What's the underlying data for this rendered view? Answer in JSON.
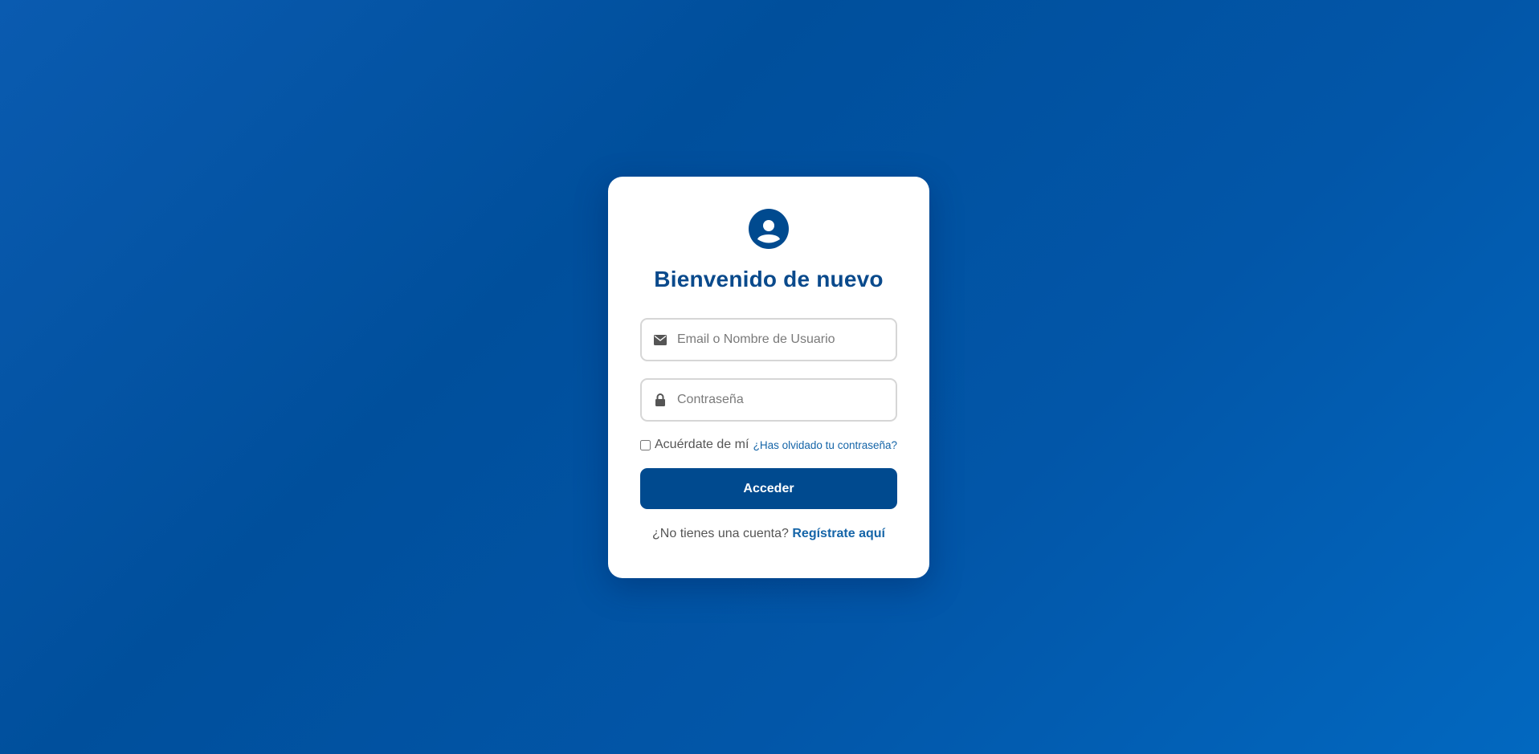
{
  "login": {
    "avatar_icon": "user-circle-icon",
    "title": "Bienvenido de nuevo",
    "username_field": {
      "icon": "envelope-icon",
      "placeholder": "Email o Nombre de Usuario",
      "value": ""
    },
    "password_field": {
      "icon": "lock-icon",
      "placeholder": "Contraseña",
      "value": ""
    },
    "remember_label": "Acuérdate de mí",
    "remember_checked": false,
    "forgot_link": "¿Has olvidado tu contraseña?",
    "submit_label": "Acceder",
    "register_prompt": "¿No tienes una cuenta?",
    "register_link": "Regístrate aquí"
  },
  "colors": {
    "primary": "#004a8f",
    "link": "#1565a8",
    "background": "#0256a8"
  }
}
